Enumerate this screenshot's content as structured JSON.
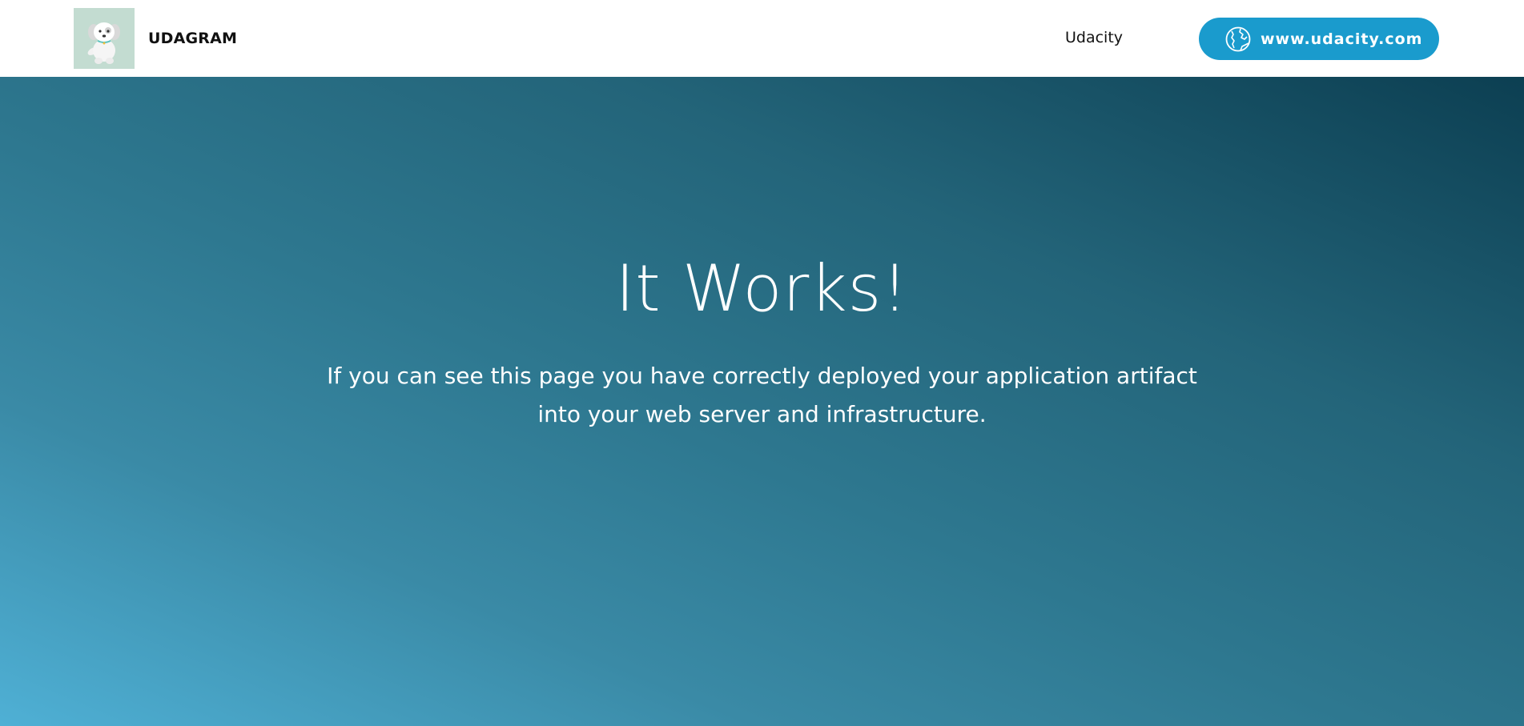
{
  "navbar": {
    "brand_name": "UDAGRAM",
    "logo_icon": "dog-logo-icon",
    "link_label": "Udacity",
    "site_button_label": "www.udacity.com",
    "site_button_icon": "globe-icon",
    "button_color": "#1a9bcd"
  },
  "hero": {
    "title": "It Works!",
    "description": "If you can see this page you have correctly deployed your application artifact into your web server and infrastructure.",
    "gradient_colors": [
      "#4fb0d5",
      "#0c3f52"
    ]
  }
}
